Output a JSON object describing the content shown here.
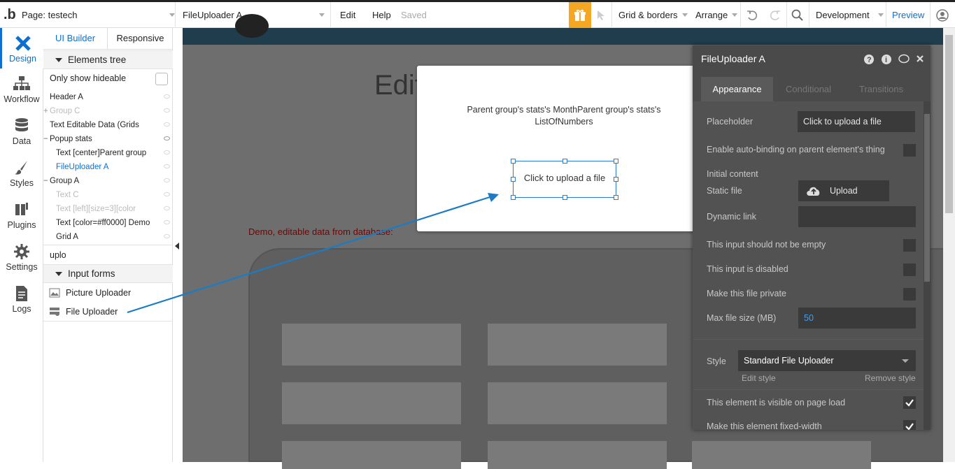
{
  "topbar": {
    "page_label": "Page: testech",
    "element_select": "FileUploader A",
    "edit": "Edit",
    "help": "Help",
    "saved": "Saved",
    "grid_borders": "Grid & borders",
    "arrange": "Arrange",
    "development": "Development",
    "preview": "Preview",
    "accent_color": "#f5a623"
  },
  "nav": [
    {
      "label": "Design",
      "icon": "design-icon"
    },
    {
      "label": "Workflow",
      "icon": "workflow-icon"
    },
    {
      "label": "Data",
      "icon": "data-icon"
    },
    {
      "label": "Styles",
      "icon": "styles-icon"
    },
    {
      "label": "Plugins",
      "icon": "plugins-icon"
    },
    {
      "label": "Settings",
      "icon": "settings-icon"
    },
    {
      "label": "Logs",
      "icon": "logs-icon"
    }
  ],
  "panel": {
    "tab_ui_builder": "UI Builder",
    "tab_responsive": "Responsive",
    "elements_tree": "Elements tree",
    "only_hideable": "Only show hideable",
    "tree": [
      "Header A",
      "Group C",
      "Text Editable Data (Grids",
      "Popup stats",
      "Text [center]Parent group",
      "FileUploader A",
      "Group A",
      "Text C",
      "Text [left][size=3][color",
      "Text [color=#ff0000] Demo",
      "Grid A"
    ],
    "search_value": "uplo",
    "input_forms": "Input forms",
    "results": [
      "Picture Uploader",
      "File Uploader"
    ]
  },
  "canvas": {
    "heading_partial": "Edit",
    "demo_text": "Demo, editable data from database:",
    "popup_text": "Parent group's stats's MonthParent group's stats's ListOfNumbers",
    "uploader_text": "Click to upload a file"
  },
  "props": {
    "title": "FileUploader A",
    "tabs": [
      "Appearance",
      "Conditional",
      "Transitions"
    ],
    "placeholder_label": "Placeholder",
    "placeholder_value": "Click to upload a file",
    "auto_binding": "Enable auto-binding on parent element's thing",
    "initial_content": "Initial content",
    "static_file": "Static file",
    "upload": "Upload",
    "dynamic_link": "Dynamic link",
    "not_empty": "This input should not be empty",
    "disabled": "This input is disabled",
    "private": "Make this file private",
    "max_size_label": "Max file size (MB)",
    "max_size_value": "50",
    "style_label": "Style",
    "style_value": "Standard File Uploader",
    "edit_style": "Edit style",
    "remove_style": "Remove style",
    "visible": "This element is visible on page load",
    "fixed_width": "Make this element fixed-width"
  }
}
